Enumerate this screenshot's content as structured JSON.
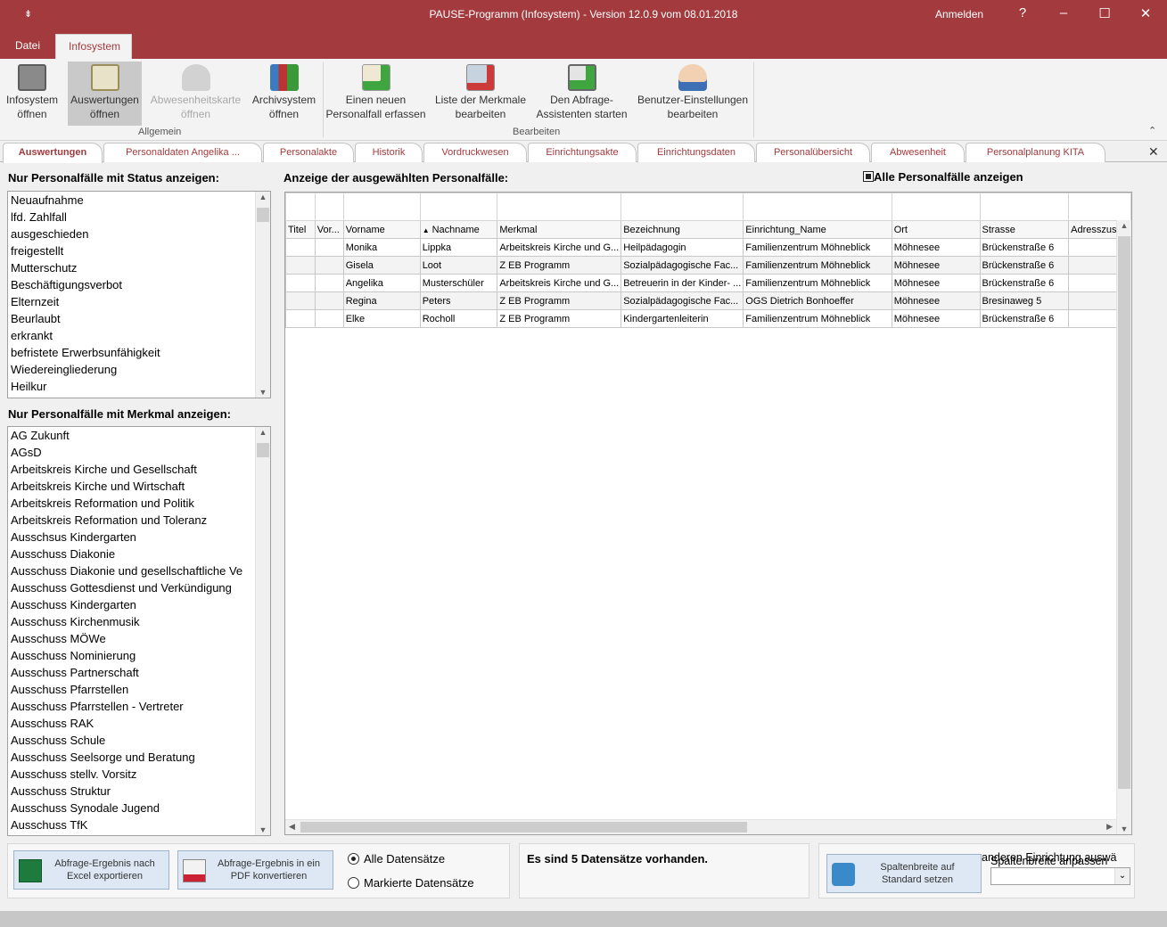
{
  "window": {
    "quick_access": "⇟",
    "title": "PAUSE-Programm (Infosystem) - Version 12.0.9 vom 08.01.2018",
    "login": "Anmelden",
    "help": "?"
  },
  "ribbon_tabs": [
    "Datei",
    "Infosystem"
  ],
  "ribbon": {
    "buttons": [
      {
        "l1": "Infosystem",
        "l2": "öffnen"
      },
      {
        "l1": "Auswertungen",
        "l2": "öffnen"
      },
      {
        "l1": "Abwesenheitskarte",
        "l2": "öffnen"
      },
      {
        "l1": "Archivsystem",
        "l2": "öffnen"
      },
      {
        "l1": "Einen neuen",
        "l2": "Personalfall erfassen"
      },
      {
        "l1": "Liste der Merkmale",
        "l2": "bearbeiten"
      },
      {
        "l1": "Den Abfrage-",
        "l2": "Assistenten starten"
      },
      {
        "l1": "Benutzer-Einstellungen",
        "l2": "bearbeiten"
      }
    ],
    "groups": [
      "Allgemein",
      "Bearbeiten"
    ]
  },
  "doc_tabs": [
    "Auswertungen",
    "Personaldaten Angelika ...",
    "Personalakte",
    "Historik",
    "Vordruckwesen",
    "Einrichtungsakte",
    "Einrichtungsdaten",
    "Personalübersicht",
    "Abwesenheit",
    "Personalplanung KITA"
  ],
  "status_filter": {
    "label": "Nur Personalfälle mit Status anzeigen:",
    "items": [
      "Neuaufnahme",
      "lfd. Zahlfall",
      "ausgeschieden",
      "freigestellt",
      "Mutterschutz",
      "Beschäftigungsverbot",
      "Elternzeit",
      "Beurlaubt",
      "erkrankt",
      "befristete Erwerbsunfähigkeit",
      "Wiedereingliederung",
      "Heilkur"
    ]
  },
  "merkmal_filter": {
    "label": "Nur Personalfälle mit Merkmal anzeigen:",
    "items": [
      "AG Zukunft",
      "AGsD",
      "Arbeitskreis Kirche und Gesellschaft",
      "Arbeitskreis Kirche und Wirtschaft",
      "Arbeitskreis Reformation und Politik",
      "Arbeitskreis Reformation und Toleranz",
      "Ausschsus Kindergarten",
      "Ausschuss Diakonie",
      "Ausschuss Diakonie und gesellschaftliche Ve",
      "Ausschuss Gottesdienst und Verkündigung",
      "Ausschuss Kindergarten",
      "Ausschuss Kirchenmusik",
      "Ausschuss MÖWe",
      "Ausschuss Nominierung",
      "Ausschuss Partnerschaft",
      "Ausschuss Pfarrstellen",
      "Ausschuss Pfarrstellen - Vertreter",
      "Ausschuss RAK",
      "Ausschuss Schule",
      "Ausschuss Seelsorge und Beratung",
      "Ausschuss stellv. Vorsitz",
      "Ausschuss Struktur",
      "Ausschuss Synodale Jugend",
      "Ausschuss TfK"
    ]
  },
  "grid": {
    "label": "Anzeige der ausgewählten Personalfälle:",
    "all_checkbox": "Alle Personalfälle anzeigen",
    "sort_glyph": "▲",
    "columns": [
      "Titel",
      "Vor...",
      "Vorname",
      "Nachname",
      "Merkmal",
      "Bezeichnung",
      "Einrichtung_Name",
      "Ort",
      "Strasse",
      "Adresszusa"
    ],
    "rows": [
      [
        "",
        "",
        "Monika",
        "Lippka",
        "Arbeitskreis Kirche und G...",
        "Heilpädagogin",
        "Familienzentrum Möhneblick",
        "Möhnesee",
        "Brückenstraße 6",
        ""
      ],
      [
        "",
        "",
        "Gisela",
        "Loot",
        "Z EB Programm",
        "Sozialpädagogische Fac...",
        "Familienzentrum Möhneblick",
        "Möhnesee",
        "Brückenstraße 6",
        ""
      ],
      [
        "",
        "",
        "Angelika",
        "Musterschüler",
        "Arbeitskreis Kirche und G...",
        "Betreuerin in der Kinder- ...",
        "Familienzentrum Möhneblick",
        "Möhnesee",
        "Brückenstraße 6",
        ""
      ],
      [
        "",
        "",
        "Regina",
        "Peters",
        "Z EB Programm",
        "Sozialpädagogische Fac...",
        "OGS Dietrich Bonhoeffer",
        "Möhnesee",
        "Bresinaweg 5",
        ""
      ],
      [
        "",
        "",
        "Elke",
        "Rocholl",
        "Z EB Programm",
        "Kindergartenleiterin",
        "Familienzentrum Möhneblick",
        "Möhnesee",
        "Brückenstraße 6",
        ""
      ]
    ]
  },
  "bottom": {
    "excel_l1": "Abfrage-Ergebnis nach",
    "excel_l2": "Excel exportieren",
    "pdf_l1": "Abfrage-Ergebnis in ein",
    "pdf_l2": "PDF konvertieren",
    "radio_all": "Alle Datensätze",
    "radio_marked": "Markierte Datensätze",
    "count_text": "Es sind 5 Datensätze vorhanden.",
    "col_l1": "Spaltenbreite auf",
    "col_l2": "Standard setzen",
    "overlap_a": "anderen Einrichtung auswä",
    "overlap_b": "Spaltenbreite anpassen"
  },
  "colors": {
    "accent": "#a33a3e"
  }
}
